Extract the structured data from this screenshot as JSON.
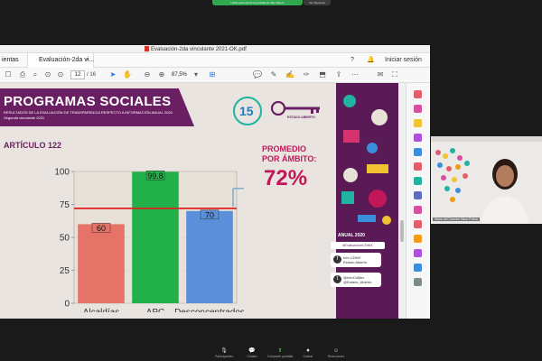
{
  "meeting": {
    "share_notice": "Usted está viendo la pantalla de Irais Tapero",
    "view_options": "Ver Opciones",
    "participant_name": "María del Carmen Nava Polina"
  },
  "viewer": {
    "window_title": "Evaluación-2da vinculante 2021-OK.pdf",
    "tab_home_partial": "ientas",
    "tab_doc_label": "Evaluación-2da vi...",
    "signin_label": "Iniciar sesión",
    "page_current": "12",
    "page_total": "/ 16",
    "zoom_value": "87,5%"
  },
  "slide": {
    "banner_title": "PROGRAMAS SOCIALES",
    "banner_subtitle": "RESULTADOS DE LA EVALUACIÓN DE TRANSPARENCIA RESPECTO A INFORMACIÓN ANUAL 2020",
    "banner_subtitle2": "Segunda vinculante 2021",
    "logo_text": "ESTADO ABIERTO",
    "logo_number": "15",
    "article_label": "ARTÍCULO 122",
    "promedio_line1": "PROMEDIO",
    "promedio_line2": "POR ÁMBITO:",
    "promedio_value": "72%",
    "anual_label": "ANUAL 2020",
    "hashtag": "#EvaluaciónCDMX",
    "social_fb_1": "Info CDMX",
    "social_fb_2": "Estado Abierto",
    "social_tw_1": "@InfoCdMex",
    "social_tw_2": "@Estado_Abierto"
  },
  "chart_data": {
    "type": "bar",
    "categories": [
      "Alcaldías",
      "APC",
      "Desconcentrados"
    ],
    "values": [
      60,
      99.8,
      70
    ],
    "value_labels": [
      "60",
      "99.8",
      "70"
    ],
    "colors": [
      "#e57368",
      "#22b04b",
      "#5b8fd9"
    ],
    "label_bg_colors": [
      "#e57368",
      "#22b04b",
      "#5b8fd9"
    ],
    "average_line": 72,
    "average_line_color": "#e02020",
    "ylim": [
      0,
      100
    ],
    "yticks": [
      0,
      25,
      50,
      75,
      100
    ],
    "ytick_labels": [
      "0",
      "25",
      "50",
      "75",
      "100"
    ],
    "grid": true
  },
  "toolbar_icons": [
    "home-icon",
    "save-icon",
    "print-icon",
    "mail-icon",
    "search-icon",
    "page-up-icon",
    "page-down-icon",
    "cursor-icon",
    "hand-icon",
    "zoom-out-icon",
    "zoom-in-icon",
    "fit-icon",
    "comment-icon",
    "pen-icon",
    "highlight-icon",
    "sign-icon",
    "share-icon"
  ],
  "zoom_controls": [
    {
      "icon": "mute-icon",
      "glyph": "🎙",
      "label": "Participantes"
    },
    {
      "icon": "chat-icon",
      "glyph": "💬",
      "label": "Chateo"
    },
    {
      "icon": "share-screen-icon",
      "glyph": "⬆",
      "label": "Compartir pantalla"
    },
    {
      "icon": "record-icon",
      "glyph": "⏺",
      "label": "Grabar"
    },
    {
      "icon": "reactions-icon",
      "glyph": "☺",
      "label": "Reacciones"
    }
  ],
  "colors": {
    "brand_purple": "#6a1f63",
    "accent_magenta": "#c2185b",
    "zoom_green": "#2fa84f"
  }
}
